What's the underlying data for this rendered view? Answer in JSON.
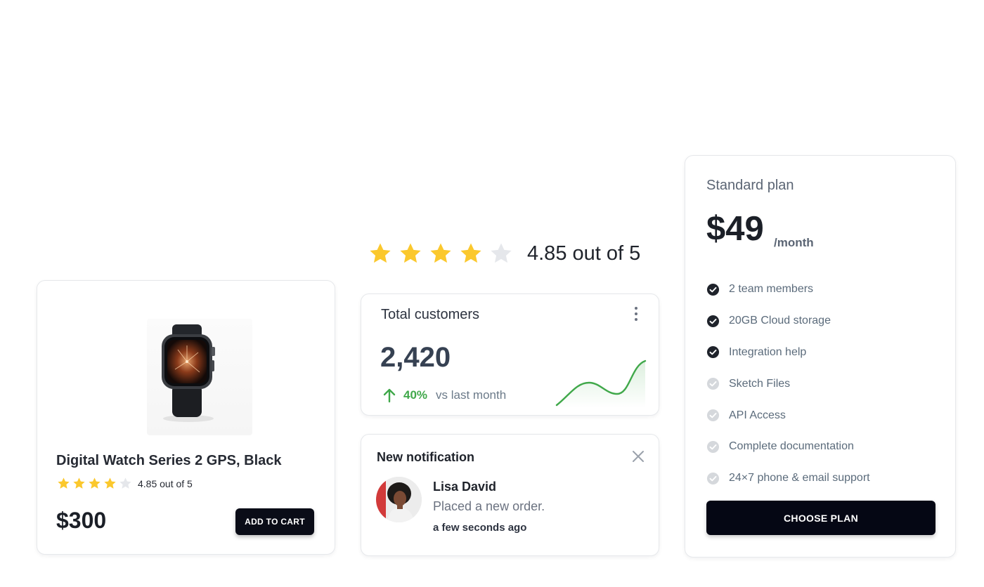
{
  "colors": {
    "star_filled": "#fbc82d",
    "star_empty": "#e5e7eb",
    "trend_green": "#40a84a",
    "check_active": "#1f232b",
    "check_inactive": "#d5d8dc",
    "button_dark": "#0a0c17"
  },
  "product": {
    "image_icon": "smartwatch-image",
    "title": "Digital Watch Series 2 GPS, Black",
    "rating_text": "4.85 out of 5",
    "stars_filled": 4,
    "stars_total": 5,
    "price": "$300",
    "add_to_cart_label": "ADD TO CART"
  },
  "big_rating": {
    "stars_filled": 4,
    "stars_total": 5,
    "text": "4.85 out of 5"
  },
  "customers": {
    "title": "Total customers",
    "more_icon": "more-vertical-icon",
    "value": "2,420",
    "trend_icon": "arrow-up-icon",
    "trend_percent": "40%",
    "trend_label": "vs last month"
  },
  "notification": {
    "title": "New notification",
    "close_icon": "close-icon",
    "name": "Lisa David",
    "message": "Placed a new order.",
    "time": "a few seconds ago"
  },
  "pricing": {
    "plan_name": "Standard plan",
    "price": "$49",
    "period": "/month",
    "features": [
      {
        "label": "2 team members",
        "included": true
      },
      {
        "label": "20GB Cloud storage",
        "included": true
      },
      {
        "label": "Integration help",
        "included": true
      },
      {
        "label": "Sketch Files",
        "included": false
      },
      {
        "label": "API Access",
        "included": false
      },
      {
        "label": "Complete documentation",
        "included": false
      },
      {
        "label": "24×7 phone & email support",
        "included": false
      }
    ],
    "button_label": "CHOOSE PLAN"
  }
}
